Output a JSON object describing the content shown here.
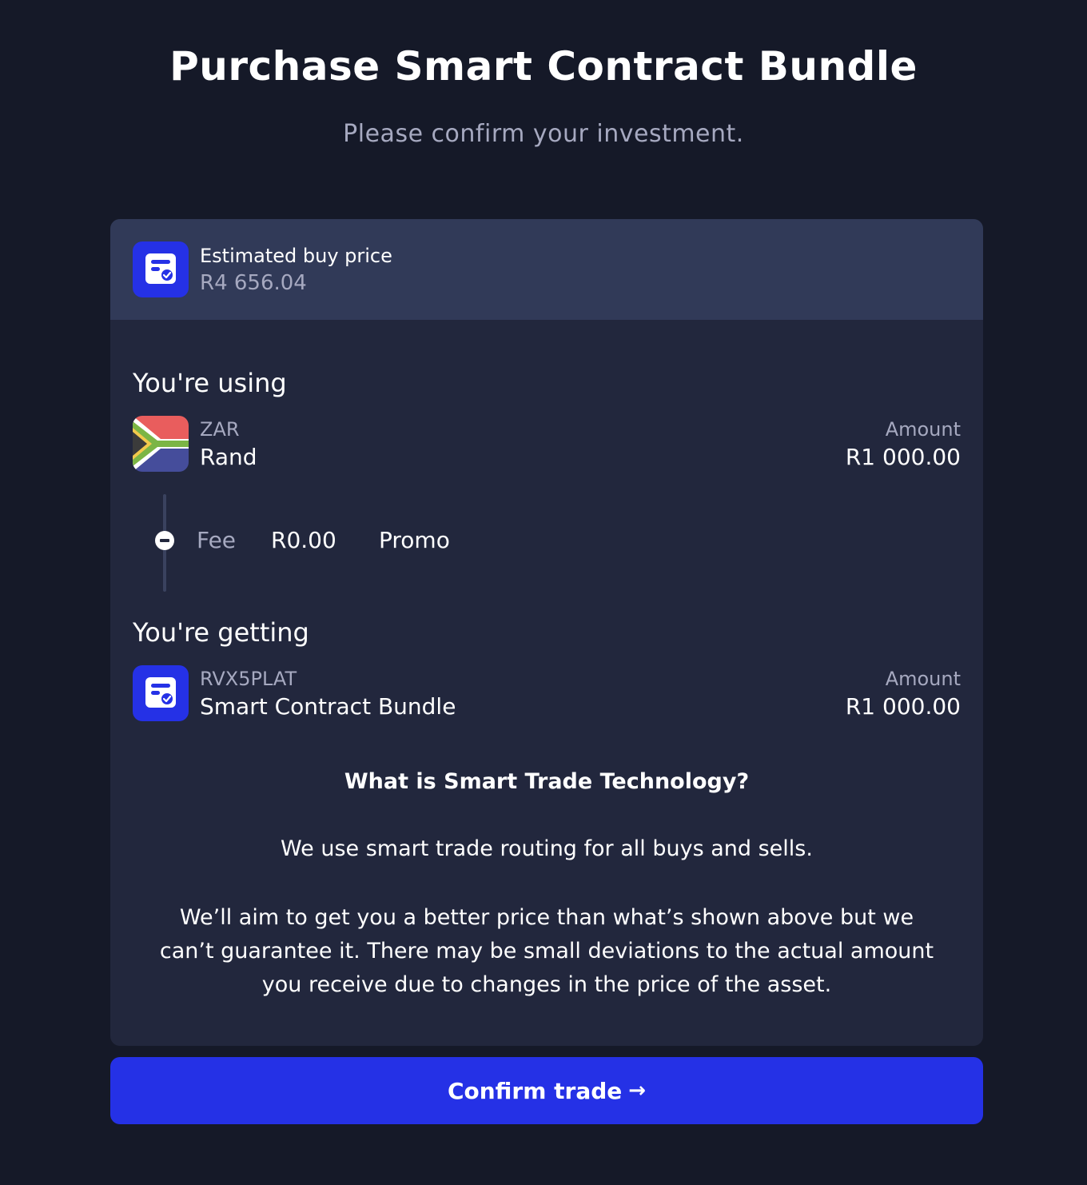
{
  "page": {
    "title": "Purchase Smart Contract Bundle",
    "subtitle": "Please confirm your investment."
  },
  "header": {
    "icon": "contract-bundle-icon",
    "label": "Estimated buy price",
    "value": "R4 656.04"
  },
  "using": {
    "heading": "You're using",
    "icon": "south-africa-flag-icon",
    "code": "ZAR",
    "name": "Rand",
    "amount_label": "Amount",
    "amount_value": "R1 000.00"
  },
  "fee": {
    "icon": "minus-circle-icon",
    "label": "Fee",
    "value": "R0.00",
    "promo": "Promo"
  },
  "getting": {
    "heading": "You're getting",
    "icon": "contract-bundle-icon",
    "code": "RVX5PLAT",
    "name": "Smart Contract Bundle",
    "amount_label": "Amount",
    "amount_value": "R1 000.00"
  },
  "info": {
    "title": "What is Smart Trade Technology?",
    "paragraph1": "We use smart trade routing for all buys and sells.",
    "paragraph2": "We’ll aim to get you a better price than what’s shown above but we can’t guarantee it. There may be small deviations to the actual amount you receive due to changes in the price of the asset."
  },
  "confirm": {
    "label": "Confirm trade",
    "arrow": "→",
    "icon": "arrow-right-icon"
  },
  "colors": {
    "background": "#151928",
    "card": "#22273d",
    "card_header": "#313a58",
    "accent": "#2531e6",
    "muted_text": "#a6a9c0"
  }
}
